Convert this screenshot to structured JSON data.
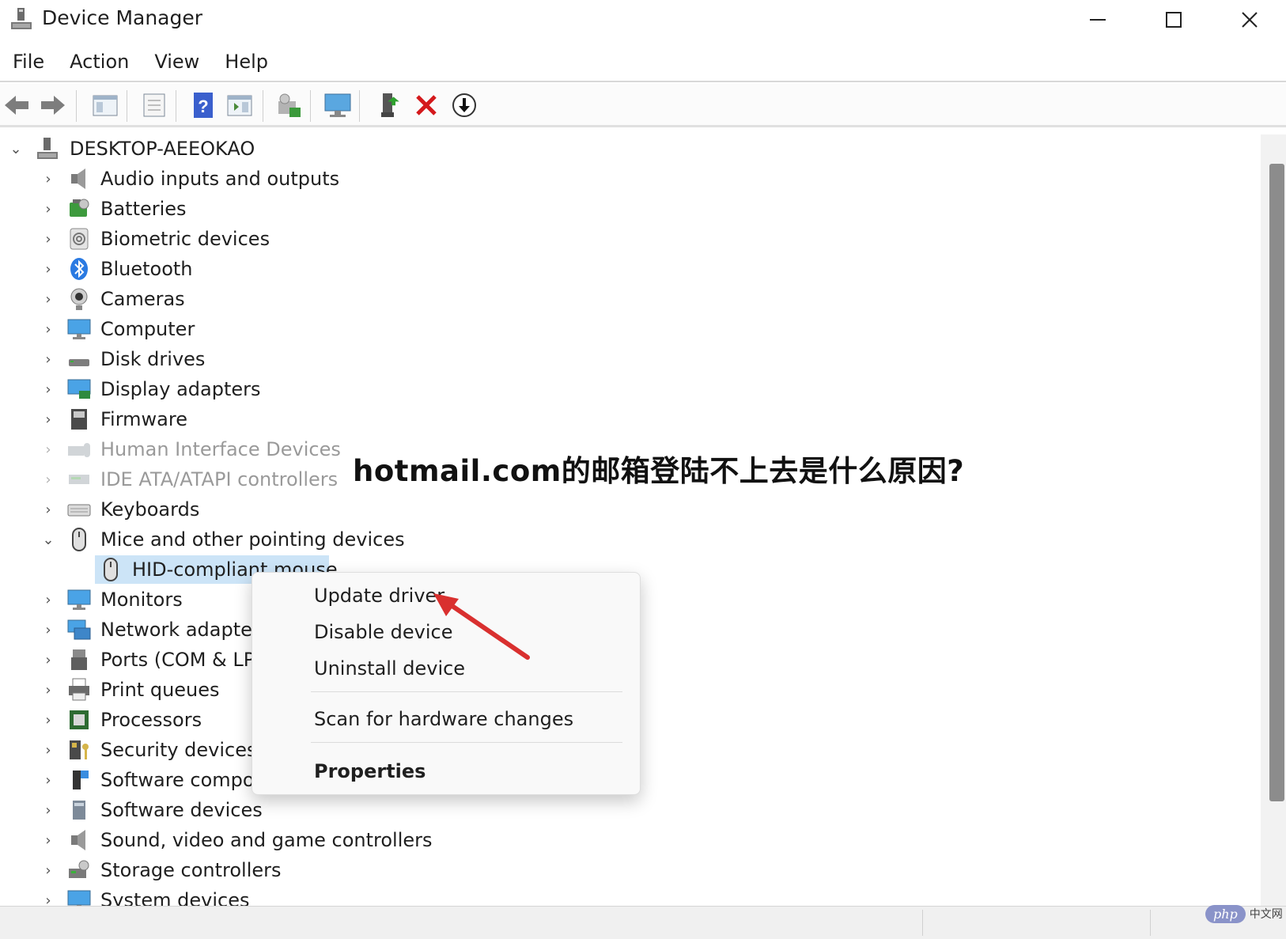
{
  "window": {
    "title": "Device Manager",
    "controls": {
      "minimize": "—",
      "maximize": "☐",
      "close": "✕"
    }
  },
  "menu": [
    "File",
    "Action",
    "View",
    "Help"
  ],
  "toolbar": {
    "buttons": [
      "back",
      "forward",
      "show-hide-console-tree",
      "properties",
      "help",
      "action-pane",
      "scan-hardware",
      "monitor",
      "update-driver",
      "uninstall",
      "disable"
    ]
  },
  "tree": {
    "root": "DESKTOP-AEEOKAO",
    "items": [
      {
        "label": "Audio inputs and outputs",
        "icon": "speaker-icon"
      },
      {
        "label": "Batteries",
        "icon": "battery-icon"
      },
      {
        "label": "Biometric devices",
        "icon": "fingerprint-icon"
      },
      {
        "label": "Bluetooth",
        "icon": "bluetooth-icon"
      },
      {
        "label": "Cameras",
        "icon": "camera-icon"
      },
      {
        "label": "Computer",
        "icon": "monitor-icon"
      },
      {
        "label": "Disk drives",
        "icon": "disk-icon"
      },
      {
        "label": "Display adapters",
        "icon": "display-adapter-icon"
      },
      {
        "label": "Firmware",
        "icon": "firmware-icon"
      },
      {
        "label": "Human Interface Devices",
        "icon": "hid-icon"
      },
      {
        "label": "IDE ATA/ATAPI controllers",
        "icon": "ide-icon"
      },
      {
        "label": "Keyboards",
        "icon": "keyboard-icon"
      },
      {
        "label": "Mice and other pointing devices",
        "icon": "mouse-icon"
      },
      {
        "label": "HID-compliant mouse",
        "icon": "mouse-icon"
      },
      {
        "label": "Monitors",
        "icon": "monitor-icon"
      },
      {
        "label": "Network adapters",
        "icon": "network-icon"
      },
      {
        "label": "Ports (COM & LPT)",
        "icon": "port-icon"
      },
      {
        "label": "Print queues",
        "icon": "printer-icon"
      },
      {
        "label": "Processors",
        "icon": "chip-icon"
      },
      {
        "label": "Security devices",
        "icon": "security-icon"
      },
      {
        "label": "Software components",
        "icon": "component-icon"
      },
      {
        "label": "Software devices",
        "icon": "software-device-icon"
      },
      {
        "label": "Sound, video and game controllers",
        "icon": "speaker-icon"
      },
      {
        "label": "Storage controllers",
        "icon": "storage-icon"
      },
      {
        "label": "System devices",
        "icon": "monitor-icon"
      }
    ]
  },
  "context_menu": {
    "items": [
      "Update driver",
      "Disable device",
      "Uninstall device",
      "Scan for hardware changes",
      "Properties"
    ]
  },
  "overlay_caption": "hotmail.com的邮箱登陆不上去是什么原因?",
  "watermark": {
    "pill": "php",
    "text": "中文网"
  },
  "colors": {
    "selection": "#cce4f7",
    "arrow": "#d9302f",
    "scrollbar_thumb": "#8c8c8c"
  }
}
